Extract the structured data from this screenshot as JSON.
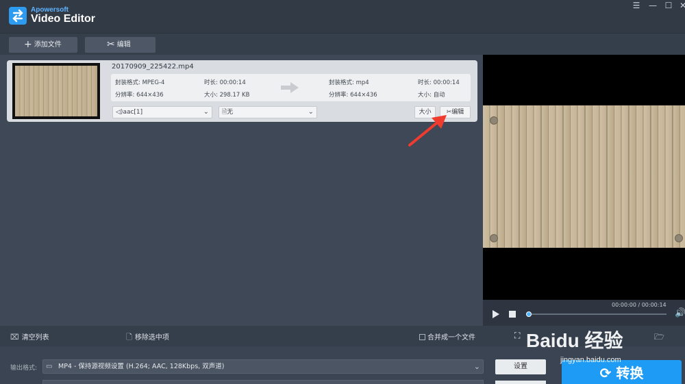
{
  "app": {
    "brand": "Apowersoft",
    "product": "Video Editor"
  },
  "window": {
    "menu_glyph": "☰",
    "minimize_glyph": "—",
    "maximize_glyph": "☐",
    "close_glyph": "✕"
  },
  "toolbar": {
    "add_file_label": "添加文件",
    "edit_label": "编辑"
  },
  "file": {
    "name": "20170909_225422.mp4",
    "source": {
      "format": "封装格式: MPEG-4",
      "resolution": "分辨率: 644×436",
      "duration": "时长: 00:00:14",
      "size": "大小: 298.17 KB"
    },
    "target": {
      "format": "封装格式: mp4",
      "resolution": "分辨率: 644×436",
      "duration": "时长: 00:00:14",
      "size": "大小: 自动"
    },
    "audio_track": "aac[1]",
    "subtitle": "无",
    "size_button": "大小",
    "edit_button": "编辑"
  },
  "player": {
    "time": "00:00:00 / 00:00:14",
    "progress_fraction": 0.0
  },
  "bottom": {
    "clear_list": "清空列表",
    "remove_selected": "移除选中项",
    "merge_into_one": "合并成一个文件"
  },
  "output": {
    "label": "输出格式:",
    "format": "MP4 - 保持源视频设置 (H.264; AAC, 128Kbps, 双声道)",
    "settings_button": "设置",
    "convert_button": "转换"
  },
  "watermark": {
    "text": "Baidu 经验",
    "url": "jingyan.baidu.com"
  },
  "colors": {
    "accent": "#1e9bf5",
    "annotation_red": "#f03b2f"
  }
}
